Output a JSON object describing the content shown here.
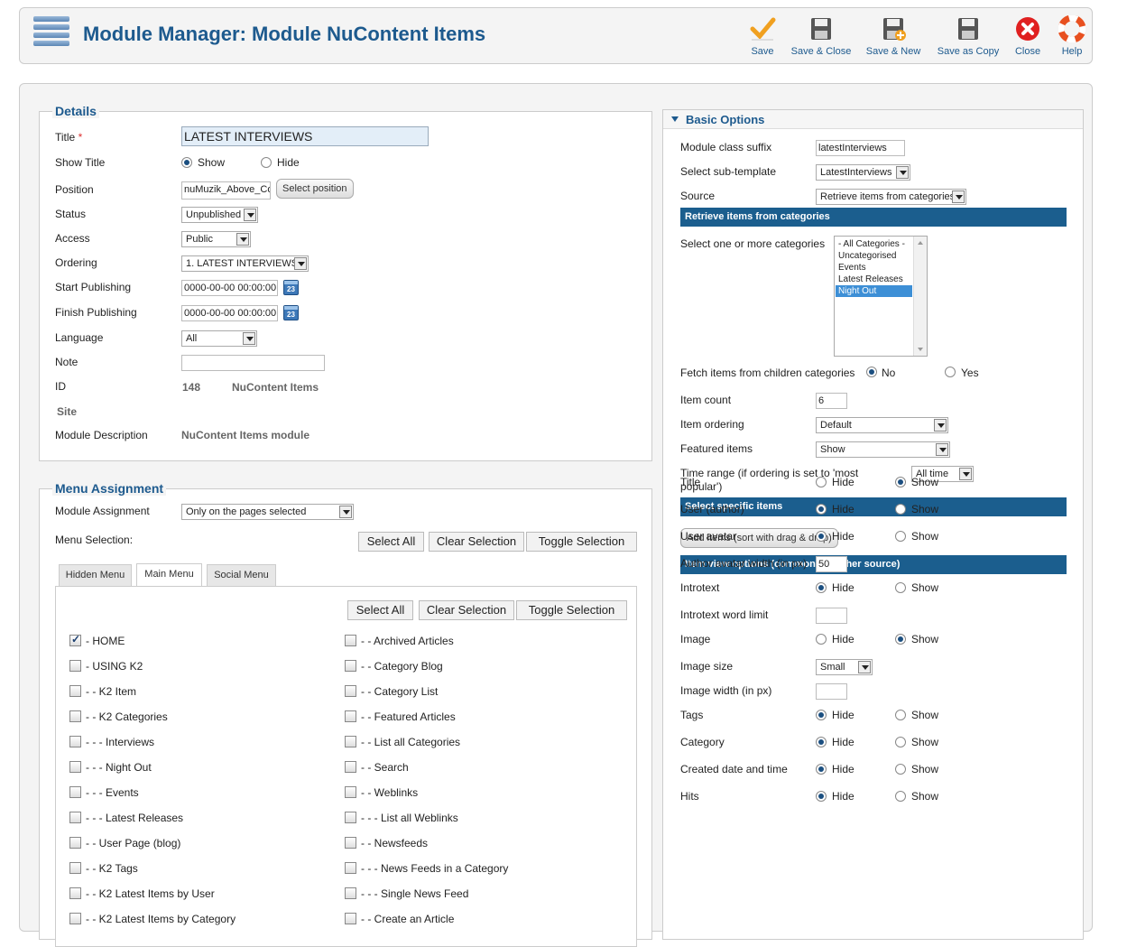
{
  "header": {
    "title": "Module Manager: Module NuContent Items",
    "buttons": [
      {
        "name": "save",
        "label": "Save",
        "icon": "checkmark-icon"
      },
      {
        "name": "save-close",
        "label": "Save & Close",
        "icon": "floppy-disk-icon"
      },
      {
        "name": "save-new",
        "label": "Save & New",
        "icon": "floppy-disk-plus-icon"
      },
      {
        "name": "save-copy",
        "label": "Save as Copy",
        "icon": "floppy-disk-copy-icon"
      },
      {
        "name": "close",
        "label": "Close",
        "icon": "close-icon"
      },
      {
        "name": "help",
        "label": "Help",
        "icon": "lifebuoy-icon"
      }
    ]
  },
  "details": {
    "legend": "Details",
    "title_label": "Title",
    "required_mark": "*",
    "title_value": "LATEST INTERVIEWS",
    "show_title_label": "Show Title",
    "show_option": "Show",
    "hide_option": "Hide",
    "position_label": "Position",
    "position_value": "nuMuzik_Above_Co",
    "select_position": "Select position",
    "status_label": "Status",
    "status_value": "Unpublished",
    "access_label": "Access",
    "access_value": "Public",
    "ordering_label": "Ordering",
    "ordering_value": "1. LATEST INTERVIEWS",
    "start_label": "Start Publishing",
    "start_value": "0000-00-00 00:00:00",
    "finish_label": "Finish Publishing",
    "finish_value": "0000-00-00 00:00:00",
    "calendar_text": "23",
    "language_label": "Language",
    "language_value": "All",
    "note_label": "Note",
    "note_value": "",
    "id_label": "ID",
    "id_value": "148",
    "type_value": "NuContent Items",
    "site_label": "Site",
    "desc_label": "Module Description",
    "desc_value": "NuContent Items module"
  },
  "menu_assignment": {
    "legend": "Menu Assignment",
    "module_assignment_label": "Module Assignment",
    "module_assignment_value": "Only on the pages selected",
    "menu_selection_label": "Menu Selection:",
    "select_all": "Select All",
    "clear_selection": "Clear Selection",
    "toggle_selection": "Toggle Selection",
    "tabs": [
      "Hidden Menu",
      "Main Menu",
      "Social Menu"
    ],
    "left_items": [
      {
        "label": "- HOME",
        "checked": true
      },
      {
        "label": "- USING K2",
        "checked": false
      },
      {
        "label": "- - K2 Item",
        "checked": false
      },
      {
        "label": "- - K2 Categories",
        "checked": false
      },
      {
        "label": "- - - Interviews",
        "checked": false
      },
      {
        "label": "- - - Night Out",
        "checked": false
      },
      {
        "label": "- - - Events",
        "checked": false
      },
      {
        "label": "- - - Latest Releases",
        "checked": false
      },
      {
        "label": "- - User Page (blog)",
        "checked": false
      },
      {
        "label": "- - K2 Tags",
        "checked": false
      },
      {
        "label": "- - K2 Latest Items by User",
        "checked": false
      },
      {
        "label": "- - K2 Latest Items by Category",
        "checked": false
      }
    ],
    "right_items": [
      {
        "label": "- - Archived Articles",
        "checked": false
      },
      {
        "label": "- - Category Blog",
        "checked": false
      },
      {
        "label": "- - Category List",
        "checked": false
      },
      {
        "label": "- - Featured Articles",
        "checked": false
      },
      {
        "label": "- - List all Categories",
        "checked": false
      },
      {
        "label": "- - Search",
        "checked": false
      },
      {
        "label": "- - Weblinks",
        "checked": false
      },
      {
        "label": "- - - List all Weblinks",
        "checked": false
      },
      {
        "label": "- - Newsfeeds",
        "checked": false
      },
      {
        "label": "- - - News Feeds in a Category",
        "checked": false
      },
      {
        "label": "- - - Single News Feed",
        "checked": false
      },
      {
        "label": "- - Create an Article",
        "checked": false
      }
    ]
  },
  "basic": {
    "header": "Basic Options",
    "class_suffix_label": "Module class suffix",
    "class_suffix_value": "latestInterviews",
    "subtemplate_label": "Select sub-template",
    "subtemplate_value": "LatestInterviews",
    "source_label": "Source",
    "source_value": "Retrieve items from categories",
    "bar_categories": "Retrieve items from categories",
    "categories_label": "Select one or more categories",
    "categories": [
      {
        "label": "- All Categories -",
        "selected": false
      },
      {
        "label": "Uncategorised",
        "selected": false
      },
      {
        "label": "Events",
        "selected": false
      },
      {
        "label": "Latest Releases",
        "selected": false
      },
      {
        "label": "Night Out",
        "selected": true
      }
    ],
    "fetch_label": "Fetch items from children categories",
    "no_option": "No",
    "yes_option": "Yes",
    "item_count_label": "Item count",
    "item_count_value": "6",
    "ordering_label": "Item ordering",
    "ordering_value": "Default",
    "featured_label": "Featured items",
    "featured_value": "Show",
    "time_range_label": "Time range (if ordering is set to 'most popular')",
    "time_range_value": "All time",
    "bar_specific": "Select specific items",
    "add_items": "Add items (sort with drag & drop)",
    "bar_view": "Item view options (common for either source)",
    "hide": "Hide",
    "show": "Show",
    "view_options": [
      {
        "label": "Title",
        "type": "radio",
        "value": "Show"
      },
      {
        "label": "User (author)",
        "type": "radio",
        "value": "Hide"
      },
      {
        "label": "User avatar",
        "type": "radio",
        "value": "Hide"
      },
      {
        "label": "Author avatar width (in px)",
        "type": "input",
        "value": "50"
      },
      {
        "label": "Introtext",
        "type": "radio",
        "value": "Hide"
      },
      {
        "label": "Introtext word limit",
        "type": "input",
        "value": ""
      },
      {
        "label": "Image",
        "type": "radio",
        "value": "Show"
      },
      {
        "label": "Image size",
        "type": "select",
        "value": "Small"
      },
      {
        "label": "Image width (in px)",
        "type": "input",
        "value": ""
      },
      {
        "label": "Tags",
        "type": "radio",
        "value": "Hide"
      },
      {
        "label": "Category",
        "type": "radio",
        "value": "Hide"
      },
      {
        "label": "Created date and time",
        "type": "radio",
        "value": "Hide"
      },
      {
        "label": "Hits",
        "type": "radio",
        "value": "Hide"
      }
    ]
  },
  "colors": {
    "accent": "#1d5a8e",
    "bar": "#1b5e8e",
    "selected": "#3d8fd6"
  }
}
